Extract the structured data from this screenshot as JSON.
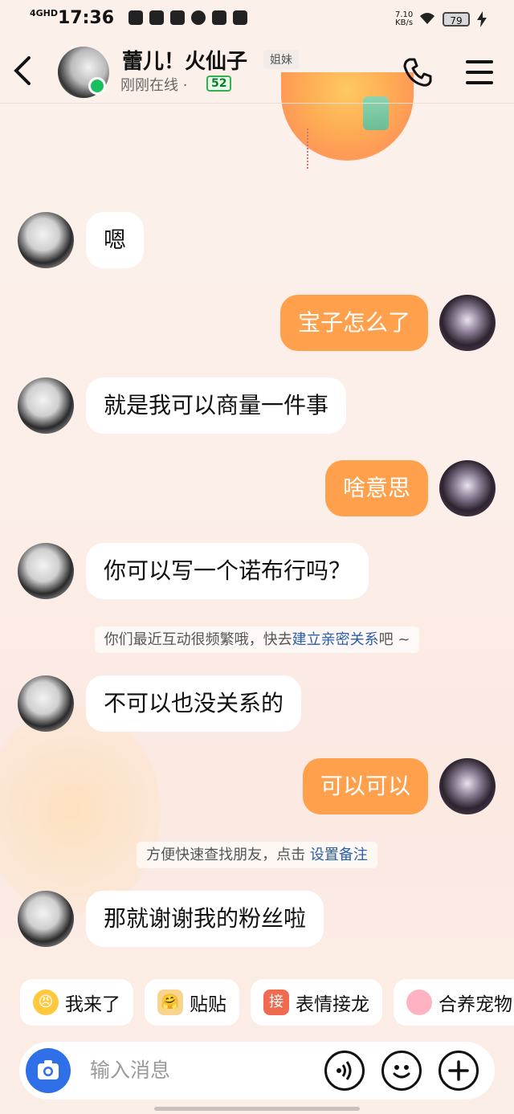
{
  "status_bar": {
    "network": "4GHD",
    "time": "17:36",
    "speed": "7.10",
    "speed_unit": "KB/s",
    "battery": "79"
  },
  "header": {
    "name": "蕾儿！火仙子",
    "tag": "姐妹",
    "status": "刚刚在线 ·",
    "level": "52"
  },
  "messages": [
    {
      "side": "left",
      "text": "嗯"
    },
    {
      "side": "right",
      "text": "宝子怎么了"
    },
    {
      "side": "left",
      "text": "就是我可以商量一件事"
    },
    {
      "side": "right",
      "text": "啥意思"
    },
    {
      "side": "left",
      "text": "你可以写一个诺布行吗？"
    },
    {
      "side": "left",
      "text": "不可以也没关系的"
    },
    {
      "side": "right",
      "text": "可以可以"
    },
    {
      "side": "left",
      "text": "那就谢谢我的粉丝啦"
    }
  ],
  "system_notes": {
    "intimacy_prefix": "你们最近互动很频繁哦，快去",
    "intimacy_link": "建立亲密关系",
    "intimacy_suffix": "吧 ~",
    "remark_prefix": "方便快速查找朋友，点击 ",
    "remark_link": "设置备注"
  },
  "quick_actions": [
    {
      "label": "我来了",
      "icon": "angry-face-icon"
    },
    {
      "label": "贴贴",
      "icon": "hug-emoji-icon"
    },
    {
      "label": "表情接龙",
      "icon": "jie-badge-icon",
      "badge": "接"
    },
    {
      "label": "合养宠物",
      "icon": "pet-icon"
    }
  ],
  "input": {
    "placeholder": "输入消息"
  },
  "colors": {
    "accent_bubble": "#ffa04d",
    "online": "#17c05c",
    "link": "#2a5fa8",
    "camera": "#2f6fe8"
  }
}
